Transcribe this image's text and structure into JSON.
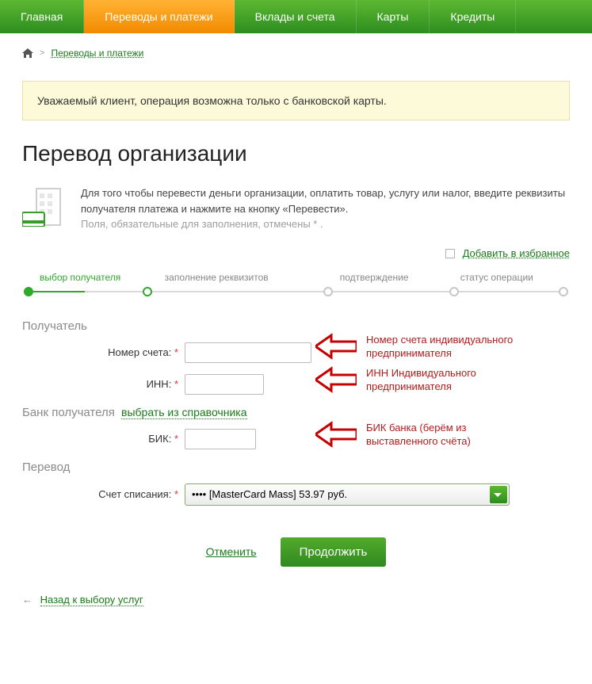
{
  "nav": {
    "items": [
      {
        "label": "Главная"
      },
      {
        "label": "Переводы и платежи"
      },
      {
        "label": "Вклады и счета"
      },
      {
        "label": "Карты"
      },
      {
        "label": "Кредиты"
      }
    ],
    "activeIndex": 1
  },
  "breadcrumb": {
    "link": "Переводы и платежи"
  },
  "notice": "Уважаемый клиент, операция возможна только с банковской карты.",
  "page_title": "Перевод организации",
  "intro": {
    "line1": "Для того чтобы перевести деньги организации, оплатить товар, услугу или налог, введите реквизиты получателя платежа и нажмите на кнопку «Перевести».",
    "line2": "Поля, обязательные для заполнения, отмечены * ."
  },
  "favorites_link": "Добавить в избранное",
  "steps": [
    {
      "label": "выбор получателя",
      "state": "active",
      "pos": 0
    },
    {
      "label": "заполнение реквизитов",
      "state": "future",
      "pos": 28
    },
    {
      "label": "подтверждение",
      "state": "future",
      "pos": 60
    },
    {
      "label": "статус операции",
      "state": "future",
      "pos": 82
    }
  ],
  "sections": {
    "recipient": "Получатель",
    "bank": "Банк получателя",
    "transfer": "Перевод"
  },
  "directory_link": "выбрать из справочника",
  "fields": {
    "account": {
      "label": "Номер счета:",
      "value": ""
    },
    "inn": {
      "label": "ИНН:",
      "value": ""
    },
    "bik": {
      "label": "БИК:",
      "value": ""
    },
    "source": {
      "label": "Счет списания:",
      "selected": "•••• [MasterCard Mass] 53.97 руб."
    }
  },
  "callouts": {
    "account": "Номер счета индивидуального предпринимателя",
    "inn": "ИНН Индивидуального предпринимателя",
    "bik": "БИК банка (берём из выставленного счёта)"
  },
  "actions": {
    "cancel": "Отменить",
    "continue": "Продолжить"
  },
  "back_link": "Назад к выбору услуг",
  "colors": {
    "green": "#2d8d1f",
    "orange": "#f28a00",
    "red": "#b01c1c",
    "noticeBg": "#fdfad9"
  }
}
